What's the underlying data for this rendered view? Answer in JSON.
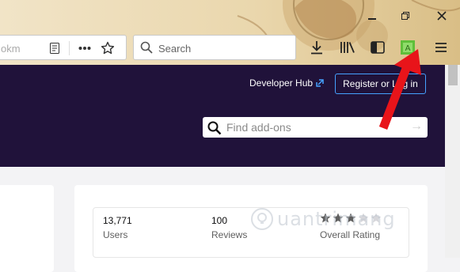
{
  "browser": {
    "address_bar": {
      "text": "okm"
    },
    "search_bar": {
      "placeholder": "Search"
    },
    "window_controls": {
      "minimize_icon": "minimize-icon",
      "restore_icon": "restore-icon",
      "close_icon": "close-icon"
    },
    "toolbar_icons": [
      "reader-view-icon",
      "page-actions-icon",
      "bookmark-star-icon",
      "download-icon",
      "library-icon",
      "sidebar-icon",
      "extension-icon",
      "menu-icon"
    ],
    "extension_color": "#5fbf3a"
  },
  "page": {
    "header": {
      "developer_hub": "Developer Hub",
      "register_button": "Register or Log in",
      "search_placeholder": "Find add-ons"
    },
    "stats": [
      {
        "value": "13,771",
        "label": "Users"
      },
      {
        "value": "100",
        "label": "Reviews"
      },
      {
        "value": "",
        "label": "Overall Rating"
      }
    ],
    "rating_stars": 3,
    "colors": {
      "header_bg": "#20123a",
      "accent": "#45a1ff",
      "arrow": "#e8141a"
    }
  },
  "watermark": "uantrimang"
}
